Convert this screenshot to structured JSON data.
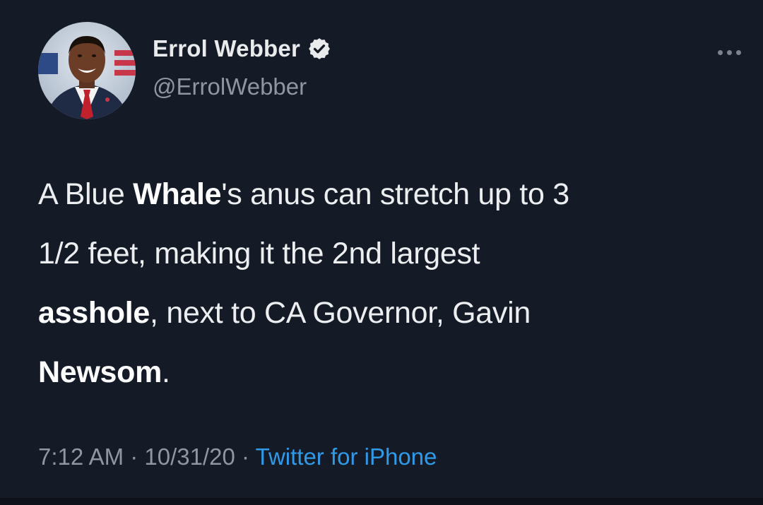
{
  "author": {
    "display_name": "Errol Webber",
    "handle": "@ErrolWebber",
    "verified": true
  },
  "tweet": {
    "t1": "A Blue ",
    "t2": "Whale",
    "t3": "'s anus can stretch up to 3",
    "t4": "1/2 feet, making it the 2nd largest",
    "t5": "asshole",
    "t6": ", next to CA Governor, Gavin",
    "t7": "Newsom",
    "t8": "."
  },
  "meta": {
    "time": "7:12 AM",
    "sep1": " · ",
    "date": "10/31/20",
    "sep2": " · ",
    "source": "Twitter for iPhone"
  },
  "icons": {
    "avatar": "profile-photo",
    "verified": "verified-badge-icon",
    "more": "more-options-icon"
  },
  "colors": {
    "background": "#151a27",
    "link": "#2f9be8",
    "secondary_text": "#8e96a0"
  }
}
